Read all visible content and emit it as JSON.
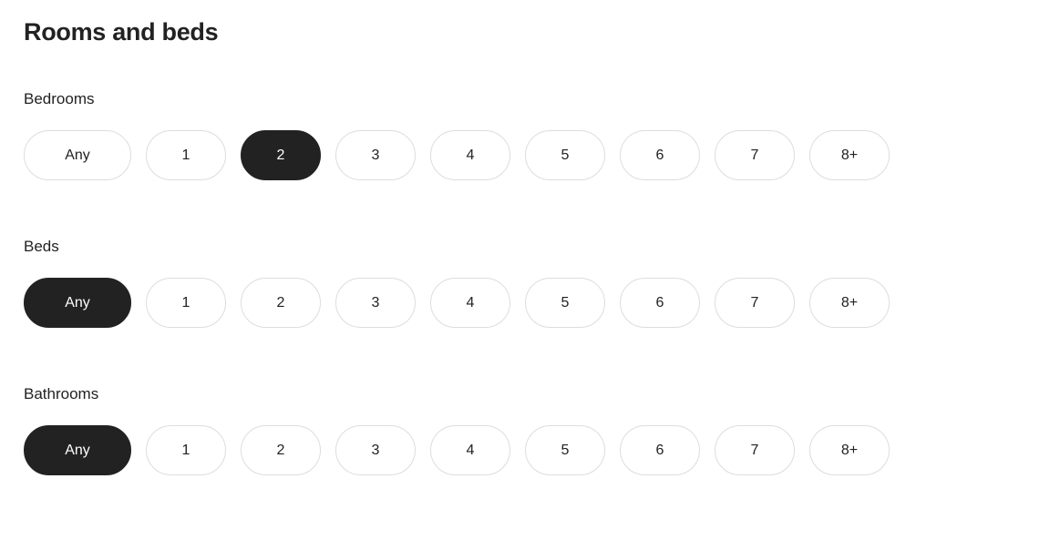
{
  "page": {
    "title": "Rooms and beds",
    "background_color": "#ffffff",
    "text_color": "#222222",
    "selected_color": "#222222",
    "border_color": "#dddddd",
    "selected_text_color": "#ffffff"
  },
  "sections": [
    {
      "label": "Bedrooms",
      "selected_value": "2",
      "options": [
        {
          "label": "Any",
          "selected": false,
          "wide": true
        },
        {
          "label": "1",
          "selected": false,
          "wide": false
        },
        {
          "label": "2",
          "selected": true,
          "wide": false
        },
        {
          "label": "3",
          "selected": false,
          "wide": false
        },
        {
          "label": "4",
          "selected": false,
          "wide": false
        },
        {
          "label": "5",
          "selected": false,
          "wide": false
        },
        {
          "label": "6",
          "selected": false,
          "wide": false
        },
        {
          "label": "7",
          "selected": false,
          "wide": false
        },
        {
          "label": "8+",
          "selected": false,
          "wide": false
        }
      ]
    },
    {
      "label": "Beds",
      "selected_value": "Any",
      "options": [
        {
          "label": "Any",
          "selected": true,
          "wide": true
        },
        {
          "label": "1",
          "selected": false,
          "wide": false
        },
        {
          "label": "2",
          "selected": false,
          "wide": false
        },
        {
          "label": "3",
          "selected": false,
          "wide": false
        },
        {
          "label": "4",
          "selected": false,
          "wide": false
        },
        {
          "label": "5",
          "selected": false,
          "wide": false
        },
        {
          "label": "6",
          "selected": false,
          "wide": false
        },
        {
          "label": "7",
          "selected": false,
          "wide": false
        },
        {
          "label": "8+",
          "selected": false,
          "wide": false
        }
      ]
    },
    {
      "label": "Bathrooms",
      "selected_value": "Any",
      "options": [
        {
          "label": "Any",
          "selected": true,
          "wide": true
        },
        {
          "label": "1",
          "selected": false,
          "wide": false
        },
        {
          "label": "2",
          "selected": false,
          "wide": false
        },
        {
          "label": "3",
          "selected": false,
          "wide": false
        },
        {
          "label": "4",
          "selected": false,
          "wide": false
        },
        {
          "label": "5",
          "selected": false,
          "wide": false
        },
        {
          "label": "6",
          "selected": false,
          "wide": false
        },
        {
          "label": "7",
          "selected": false,
          "wide": false
        },
        {
          "label": "8+",
          "selected": false,
          "wide": false
        }
      ]
    }
  ]
}
